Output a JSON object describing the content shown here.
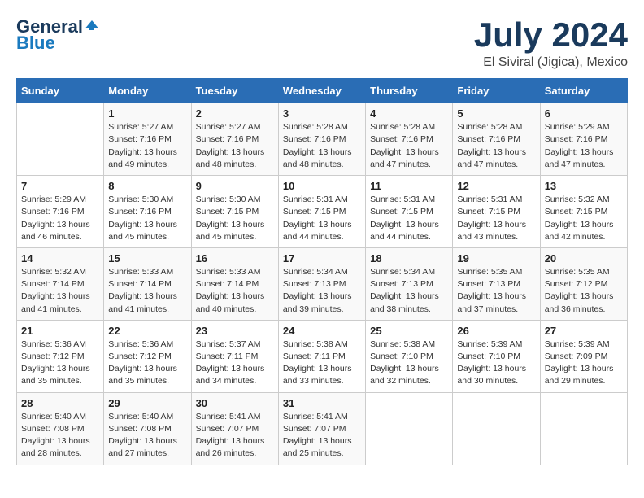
{
  "header": {
    "logo_general": "General",
    "logo_blue": "Blue",
    "month": "July 2024",
    "location": "El Siviral (Jigica), Mexico"
  },
  "days_of_week": [
    "Sunday",
    "Monday",
    "Tuesday",
    "Wednesday",
    "Thursday",
    "Friday",
    "Saturday"
  ],
  "weeks": [
    [
      {
        "day": "",
        "sunrise": "",
        "sunset": "",
        "daylight": ""
      },
      {
        "day": "1",
        "sunrise": "Sunrise: 5:27 AM",
        "sunset": "Sunset: 7:16 PM",
        "daylight": "Daylight: 13 hours and 49 minutes."
      },
      {
        "day": "2",
        "sunrise": "Sunrise: 5:27 AM",
        "sunset": "Sunset: 7:16 PM",
        "daylight": "Daylight: 13 hours and 48 minutes."
      },
      {
        "day": "3",
        "sunrise": "Sunrise: 5:28 AM",
        "sunset": "Sunset: 7:16 PM",
        "daylight": "Daylight: 13 hours and 48 minutes."
      },
      {
        "day": "4",
        "sunrise": "Sunrise: 5:28 AM",
        "sunset": "Sunset: 7:16 PM",
        "daylight": "Daylight: 13 hours and 47 minutes."
      },
      {
        "day": "5",
        "sunrise": "Sunrise: 5:28 AM",
        "sunset": "Sunset: 7:16 PM",
        "daylight": "Daylight: 13 hours and 47 minutes."
      },
      {
        "day": "6",
        "sunrise": "Sunrise: 5:29 AM",
        "sunset": "Sunset: 7:16 PM",
        "daylight": "Daylight: 13 hours and 47 minutes."
      }
    ],
    [
      {
        "day": "7",
        "sunrise": "Sunrise: 5:29 AM",
        "sunset": "Sunset: 7:16 PM",
        "daylight": "Daylight: 13 hours and 46 minutes."
      },
      {
        "day": "8",
        "sunrise": "Sunrise: 5:30 AM",
        "sunset": "Sunset: 7:16 PM",
        "daylight": "Daylight: 13 hours and 45 minutes."
      },
      {
        "day": "9",
        "sunrise": "Sunrise: 5:30 AM",
        "sunset": "Sunset: 7:15 PM",
        "daylight": "Daylight: 13 hours and 45 minutes."
      },
      {
        "day": "10",
        "sunrise": "Sunrise: 5:31 AM",
        "sunset": "Sunset: 7:15 PM",
        "daylight": "Daylight: 13 hours and 44 minutes."
      },
      {
        "day": "11",
        "sunrise": "Sunrise: 5:31 AM",
        "sunset": "Sunset: 7:15 PM",
        "daylight": "Daylight: 13 hours and 44 minutes."
      },
      {
        "day": "12",
        "sunrise": "Sunrise: 5:31 AM",
        "sunset": "Sunset: 7:15 PM",
        "daylight": "Daylight: 13 hours and 43 minutes."
      },
      {
        "day": "13",
        "sunrise": "Sunrise: 5:32 AM",
        "sunset": "Sunset: 7:15 PM",
        "daylight": "Daylight: 13 hours and 42 minutes."
      }
    ],
    [
      {
        "day": "14",
        "sunrise": "Sunrise: 5:32 AM",
        "sunset": "Sunset: 7:14 PM",
        "daylight": "Daylight: 13 hours and 41 minutes."
      },
      {
        "day": "15",
        "sunrise": "Sunrise: 5:33 AM",
        "sunset": "Sunset: 7:14 PM",
        "daylight": "Daylight: 13 hours and 41 minutes."
      },
      {
        "day": "16",
        "sunrise": "Sunrise: 5:33 AM",
        "sunset": "Sunset: 7:14 PM",
        "daylight": "Daylight: 13 hours and 40 minutes."
      },
      {
        "day": "17",
        "sunrise": "Sunrise: 5:34 AM",
        "sunset": "Sunset: 7:13 PM",
        "daylight": "Daylight: 13 hours and 39 minutes."
      },
      {
        "day": "18",
        "sunrise": "Sunrise: 5:34 AM",
        "sunset": "Sunset: 7:13 PM",
        "daylight": "Daylight: 13 hours and 38 minutes."
      },
      {
        "day": "19",
        "sunrise": "Sunrise: 5:35 AM",
        "sunset": "Sunset: 7:13 PM",
        "daylight": "Daylight: 13 hours and 37 minutes."
      },
      {
        "day": "20",
        "sunrise": "Sunrise: 5:35 AM",
        "sunset": "Sunset: 7:12 PM",
        "daylight": "Daylight: 13 hours and 36 minutes."
      }
    ],
    [
      {
        "day": "21",
        "sunrise": "Sunrise: 5:36 AM",
        "sunset": "Sunset: 7:12 PM",
        "daylight": "Daylight: 13 hours and 35 minutes."
      },
      {
        "day": "22",
        "sunrise": "Sunrise: 5:36 AM",
        "sunset": "Sunset: 7:12 PM",
        "daylight": "Daylight: 13 hours and 35 minutes."
      },
      {
        "day": "23",
        "sunrise": "Sunrise: 5:37 AM",
        "sunset": "Sunset: 7:11 PM",
        "daylight": "Daylight: 13 hours and 34 minutes."
      },
      {
        "day": "24",
        "sunrise": "Sunrise: 5:38 AM",
        "sunset": "Sunset: 7:11 PM",
        "daylight": "Daylight: 13 hours and 33 minutes."
      },
      {
        "day": "25",
        "sunrise": "Sunrise: 5:38 AM",
        "sunset": "Sunset: 7:10 PM",
        "daylight": "Daylight: 13 hours and 32 minutes."
      },
      {
        "day": "26",
        "sunrise": "Sunrise: 5:39 AM",
        "sunset": "Sunset: 7:10 PM",
        "daylight": "Daylight: 13 hours and 30 minutes."
      },
      {
        "day": "27",
        "sunrise": "Sunrise: 5:39 AM",
        "sunset": "Sunset: 7:09 PM",
        "daylight": "Daylight: 13 hours and 29 minutes."
      }
    ],
    [
      {
        "day": "28",
        "sunrise": "Sunrise: 5:40 AM",
        "sunset": "Sunset: 7:08 PM",
        "daylight": "Daylight: 13 hours and 28 minutes."
      },
      {
        "day": "29",
        "sunrise": "Sunrise: 5:40 AM",
        "sunset": "Sunset: 7:08 PM",
        "daylight": "Daylight: 13 hours and 27 minutes."
      },
      {
        "day": "30",
        "sunrise": "Sunrise: 5:41 AM",
        "sunset": "Sunset: 7:07 PM",
        "daylight": "Daylight: 13 hours and 26 minutes."
      },
      {
        "day": "31",
        "sunrise": "Sunrise: 5:41 AM",
        "sunset": "Sunset: 7:07 PM",
        "daylight": "Daylight: 13 hours and 25 minutes."
      },
      {
        "day": "",
        "sunrise": "",
        "sunset": "",
        "daylight": ""
      },
      {
        "day": "",
        "sunrise": "",
        "sunset": "",
        "daylight": ""
      },
      {
        "day": "",
        "sunrise": "",
        "sunset": "",
        "daylight": ""
      }
    ]
  ]
}
